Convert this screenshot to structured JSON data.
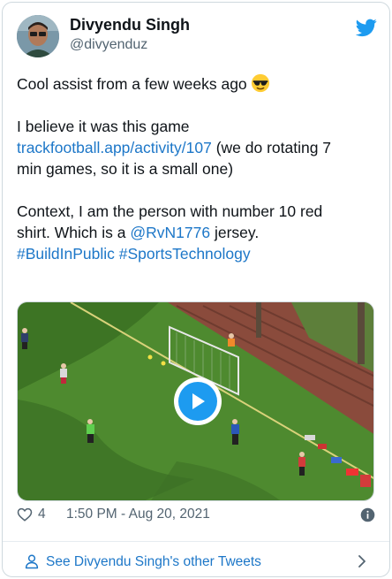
{
  "author": {
    "name": "Divyendu Singh",
    "handle": "@divyenduz"
  },
  "icons": {
    "brand": "twitter-bird-icon",
    "emoji": "smiling-face-with-sunglasses",
    "like": "heart-outline-icon",
    "info": "info-circle-icon",
    "profile": "person-outline-icon",
    "more": "chevron-right-icon",
    "play": "play-icon"
  },
  "tweet": {
    "line1": "Cool assist from a few weeks ago",
    "line2": "I believe it was this game",
    "link": "trackfootball.app/activity/107",
    "line3_after_link": " (we do rotating 7",
    "line4": "min games, so it is a small one)",
    "line5": "Context, I am the person with number 10 red",
    "line6_before_mention": "shirt. Which is a ",
    "mention": "@RvN1776",
    "line6_after_mention": " jersey.",
    "hashtags": [
      "#BuildInPublic",
      "#SportsTechnology"
    ]
  },
  "stats": {
    "likes": "4",
    "timestamp": "1:50 PM - Aug 20, 2021"
  },
  "footer": {
    "label": "See Divyendu Singh's other Tweets"
  },
  "colors": {
    "link": "#1d77c8",
    "brand_blue": "#1d9bf0",
    "secondary_text": "#536471",
    "grass": "#4e8a2f"
  }
}
